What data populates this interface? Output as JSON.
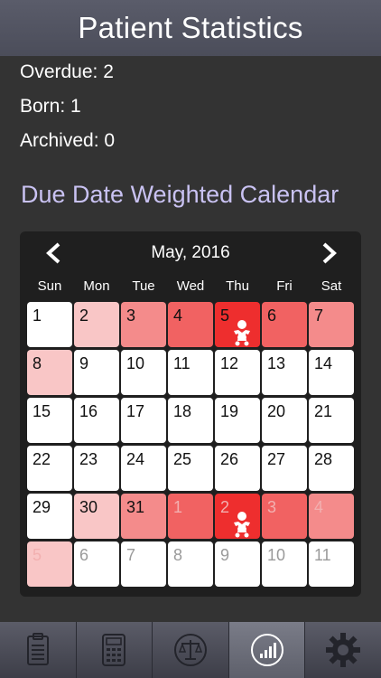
{
  "header": {
    "title": "Patient Statistics"
  },
  "stats": {
    "overdue": "Overdue: 2",
    "born": "Born: 1",
    "archived": "Archived: 0"
  },
  "calendar": {
    "title": "Due Date Weighted Calendar",
    "month_label": "May, 2016",
    "weekdays": [
      "Sun",
      "Mon",
      "Tue",
      "Wed",
      "Thu",
      "Fri",
      "Sat"
    ],
    "weeks": [
      [
        {
          "day": "1",
          "heat": 0
        },
        {
          "day": "2",
          "heat": 1
        },
        {
          "day": "3",
          "heat": 2
        },
        {
          "day": "4",
          "heat": 3
        },
        {
          "day": "5",
          "heat": 4,
          "baby": true
        },
        {
          "day": "6",
          "heat": 3
        },
        {
          "day": "7",
          "heat": 2
        }
      ],
      [
        {
          "day": "8",
          "heat": 1
        },
        {
          "day": "9",
          "heat": 0
        },
        {
          "day": "10",
          "heat": 0
        },
        {
          "day": "11",
          "heat": 0
        },
        {
          "day": "12",
          "heat": 0
        },
        {
          "day": "13",
          "heat": 0
        },
        {
          "day": "14",
          "heat": 0
        }
      ],
      [
        {
          "day": "15",
          "heat": 0
        },
        {
          "day": "16",
          "heat": 0
        },
        {
          "day": "17",
          "heat": 0
        },
        {
          "day": "18",
          "heat": 0
        },
        {
          "day": "19",
          "heat": 0
        },
        {
          "day": "20",
          "heat": 0
        },
        {
          "day": "21",
          "heat": 0
        }
      ],
      [
        {
          "day": "22",
          "heat": 0
        },
        {
          "day": "23",
          "heat": 0
        },
        {
          "day": "24",
          "heat": 0
        },
        {
          "day": "25",
          "heat": 0
        },
        {
          "day": "26",
          "heat": 0
        },
        {
          "day": "27",
          "heat": 0
        },
        {
          "day": "28",
          "heat": 0
        }
      ],
      [
        {
          "day": "29",
          "heat": 0
        },
        {
          "day": "30",
          "heat": 1
        },
        {
          "day": "31",
          "heat": 2
        },
        {
          "day": "1",
          "heat": 3,
          "other": true
        },
        {
          "day": "2",
          "heat": 4,
          "other": true,
          "baby": true
        },
        {
          "day": "3",
          "heat": 3,
          "other": true
        },
        {
          "day": "4",
          "heat": 2,
          "other": true
        }
      ],
      [
        {
          "day": "5",
          "heat": 1,
          "other": true
        },
        {
          "day": "6",
          "heat": 0,
          "other": true
        },
        {
          "day": "7",
          "heat": 0,
          "other": true
        },
        {
          "day": "8",
          "heat": 0,
          "other": true
        },
        {
          "day": "9",
          "heat": 0,
          "other": true
        },
        {
          "day": "10",
          "heat": 0,
          "other": true
        },
        {
          "day": "11",
          "heat": 0,
          "other": true
        }
      ]
    ],
    "heat_colors": [
      "#ffffff",
      "#f9c6c6",
      "#f48b8b",
      "#f16262",
      "#ee2e2e"
    ]
  },
  "tabbar": {
    "tabs": [
      {
        "icon": "clipboard-icon",
        "active": false
      },
      {
        "icon": "calculator-icon",
        "active": false
      },
      {
        "icon": "scale-icon",
        "active": false
      },
      {
        "icon": "statistics-icon",
        "active": true
      },
      {
        "icon": "gear-icon",
        "active": false
      }
    ]
  }
}
